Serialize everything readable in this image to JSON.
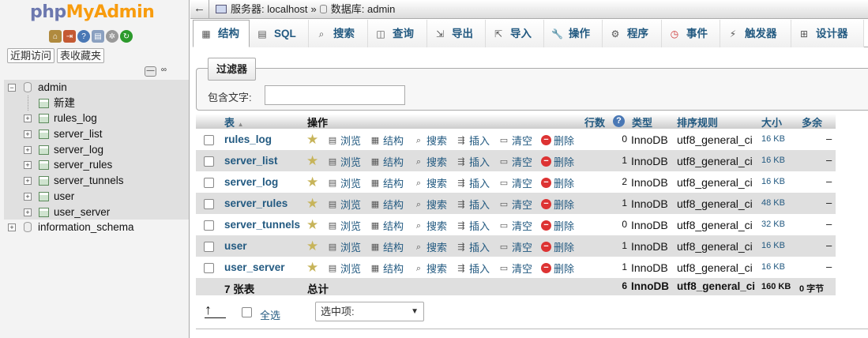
{
  "left": {
    "logo": {
      "php": "php",
      "myadmin": "MyAdmin"
    },
    "nav_buttons": [
      "近期访问",
      "表收藏夹"
    ],
    "databases": [
      {
        "name": "admin",
        "expanded": true,
        "items": [
          "新建",
          "rules_log",
          "server_list",
          "server_log",
          "server_rules",
          "server_tunnels",
          "user",
          "user_server"
        ]
      },
      {
        "name": "information_schema",
        "expanded": false
      }
    ]
  },
  "breadcrumb": {
    "server": "服务器: localhost",
    "sep": "»",
    "database": "数据库: admin"
  },
  "tabs": [
    {
      "label": "结构",
      "icon": "structure-icon"
    },
    {
      "label": "SQL",
      "icon": "sql-icon"
    },
    {
      "label": "搜索",
      "icon": "search-icon"
    },
    {
      "label": "查询",
      "icon": "query-icon"
    },
    {
      "label": "导出",
      "icon": "export-icon"
    },
    {
      "label": "导入",
      "icon": "import-icon"
    },
    {
      "label": "操作",
      "icon": "wrench-icon"
    },
    {
      "label": "程序",
      "icon": "routines-icon"
    },
    {
      "label": "事件",
      "icon": "events-icon"
    },
    {
      "label": "触发器",
      "icon": "triggers-icon"
    },
    {
      "label": "设计器",
      "icon": "designer-icon"
    }
  ],
  "filter": {
    "legend": "过滤器",
    "label": "包含文字:",
    "value": ""
  },
  "table": {
    "headers": {
      "name": "表",
      "sort": "▲",
      "action": "操作",
      "rows": "行数",
      "type": "类型",
      "collation": "排序规则",
      "size": "大小",
      "overhead": "多余"
    },
    "action_labels": {
      "browse": "浏览",
      "structure": "结构",
      "search": "搜索",
      "insert": "插入",
      "empty": "清空",
      "drop": "删除"
    },
    "rows": [
      {
        "name": "rules_log",
        "rows": "0",
        "type": "InnoDB",
        "collation": "utf8_general_ci",
        "size": "16 KB",
        "overhead": "–"
      },
      {
        "name": "server_list",
        "rows": "1",
        "type": "InnoDB",
        "collation": "utf8_general_ci",
        "size": "16 KB",
        "overhead": "–"
      },
      {
        "name": "server_log",
        "rows": "2",
        "type": "InnoDB",
        "collation": "utf8_general_ci",
        "size": "16 KB",
        "overhead": "–"
      },
      {
        "name": "server_rules",
        "rows": "1",
        "type": "InnoDB",
        "collation": "utf8_general_ci",
        "size": "48 KB",
        "overhead": "–"
      },
      {
        "name": "server_tunnels",
        "rows": "0",
        "type": "InnoDB",
        "collation": "utf8_general_ci",
        "size": "32 KB",
        "overhead": "–"
      },
      {
        "name": "user",
        "rows": "1",
        "type": "InnoDB",
        "collation": "utf8_general_ci",
        "size": "16 KB",
        "overhead": "–"
      },
      {
        "name": "user_server",
        "rows": "1",
        "type": "InnoDB",
        "collation": "utf8_general_ci",
        "size": "16 KB",
        "overhead": "–"
      }
    ],
    "footer": {
      "count": "7 张表",
      "label": "总计",
      "rows": "6",
      "type": "InnoDB",
      "collation": "utf8_general_ci",
      "size": "160 KB",
      "overhead": "0 字节"
    }
  },
  "bottom": {
    "select_all": "全选",
    "with_selected": "选中项:"
  }
}
